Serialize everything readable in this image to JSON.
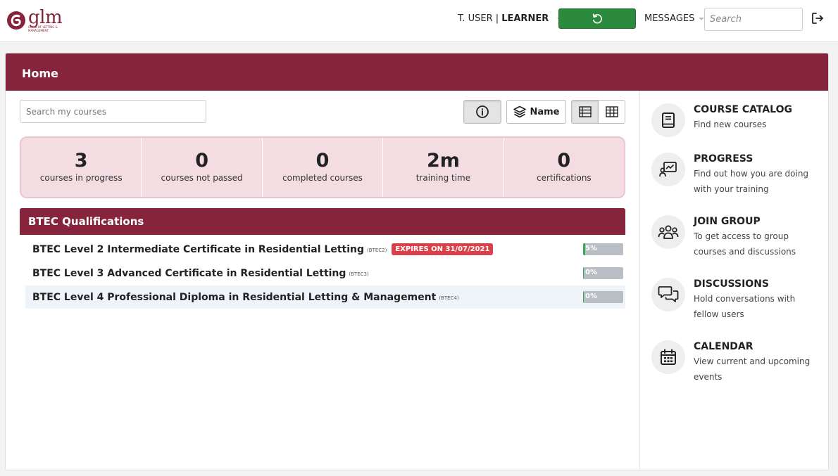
{
  "header": {
    "logo_word": "glm",
    "logo_sub": "GUILD OF LETTING & MANAGEMENT",
    "user_name": "T. USER |",
    "user_role": "LEARNER",
    "messages_label": "MESSAGES",
    "search_placeholder": "Search"
  },
  "page": {
    "title": "Home",
    "course_search_placeholder": "Search my courses",
    "sort_label": "Name"
  },
  "stats": [
    {
      "value": "3",
      "label": "courses in progress"
    },
    {
      "value": "0",
      "label": "courses not passed"
    },
    {
      "value": "0",
      "label": "completed courses"
    },
    {
      "value": "2m",
      "label": "training time"
    },
    {
      "value": "0",
      "label": "certifications"
    }
  ],
  "group": {
    "title": "BTEC Qualifications",
    "courses": [
      {
        "title": "BTEC Level 2 Intermediate Certificate in Residential Letting",
        "code": "(BTEC2)",
        "expiry": "EXPIRES ON 31/07/2021",
        "progress": 5,
        "progress_text": "5%"
      },
      {
        "title": "BTEC Level 3 Advanced Certificate in Residential Letting",
        "code": "(BTEC3)",
        "expiry": "",
        "progress": 0,
        "progress_text": "0%"
      },
      {
        "title": "BTEC Level 4 Professional Diploma in Residential Letting & Management",
        "code": "(BTEC4)",
        "expiry": "",
        "progress": 0,
        "progress_text": "0%"
      }
    ]
  },
  "sidebar": {
    "items": [
      {
        "title": "COURSE CATALOG",
        "desc": "Find new courses",
        "icon": "book-icon"
      },
      {
        "title": "PROGRESS",
        "desc": "Find out how you are doing with your training",
        "icon": "progress-chart-icon"
      },
      {
        "title": "JOIN GROUP",
        "desc": "To get access to group courses and discussions",
        "icon": "group-icon"
      },
      {
        "title": "DISCUSSIONS",
        "desc": "Hold conversations with fellow users",
        "icon": "chat-bubbles-icon"
      },
      {
        "title": "CALENDAR",
        "desc": "View current and upcoming events",
        "icon": "calendar-icon"
      }
    ]
  },
  "colors": {
    "brand": "#85243a",
    "refresh_button": "#2b8a3e",
    "stats_bg": "#f4dde2",
    "expiry_badge": "#d9404a",
    "progress_fill": "#3aa65a",
    "progress_track": "#b8bec3"
  }
}
